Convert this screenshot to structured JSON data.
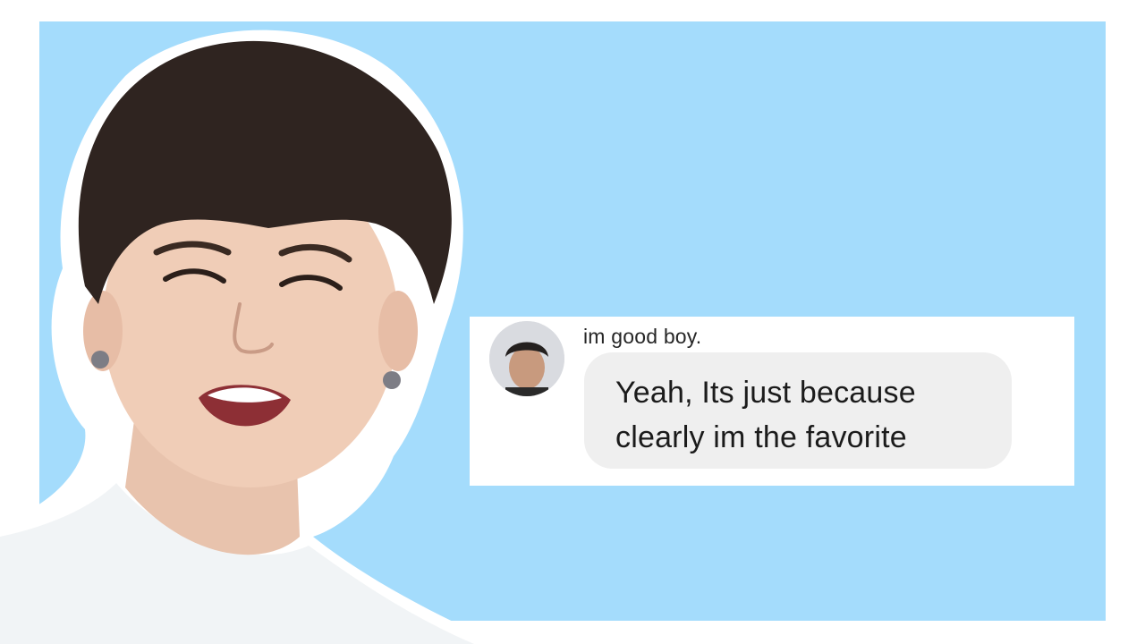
{
  "colors": {
    "background": "#a4dcfc",
    "card": "#ffffff",
    "bubble": "#efefef",
    "text": "#262626"
  },
  "chat": {
    "username": "im good boy.",
    "message": "Yeah, Its just because\nclearly im the favorite"
  },
  "icons": {
    "avatar": "profile-photo-icon"
  }
}
